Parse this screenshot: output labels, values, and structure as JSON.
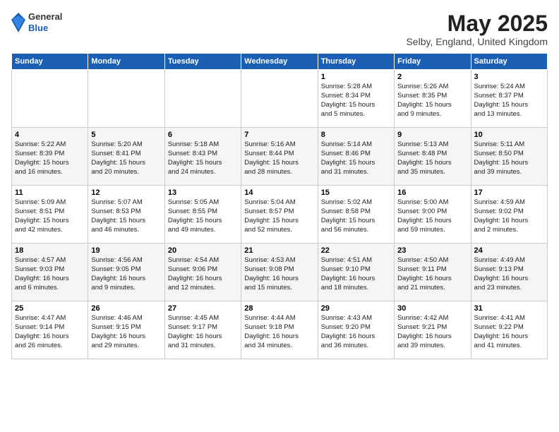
{
  "header": {
    "logo_general": "General",
    "logo_blue": "Blue",
    "month_title": "May 2025",
    "location": "Selby, England, United Kingdom"
  },
  "weekdays": [
    "Sunday",
    "Monday",
    "Tuesday",
    "Wednesday",
    "Thursday",
    "Friday",
    "Saturday"
  ],
  "weeks": [
    [
      {
        "day": "",
        "info": ""
      },
      {
        "day": "",
        "info": ""
      },
      {
        "day": "",
        "info": ""
      },
      {
        "day": "",
        "info": ""
      },
      {
        "day": "1",
        "info": "Sunrise: 5:28 AM\nSunset: 8:34 PM\nDaylight: 15 hours\nand 5 minutes."
      },
      {
        "day": "2",
        "info": "Sunrise: 5:26 AM\nSunset: 8:35 PM\nDaylight: 15 hours\nand 9 minutes."
      },
      {
        "day": "3",
        "info": "Sunrise: 5:24 AM\nSunset: 8:37 PM\nDaylight: 15 hours\nand 13 minutes."
      }
    ],
    [
      {
        "day": "4",
        "info": "Sunrise: 5:22 AM\nSunset: 8:39 PM\nDaylight: 15 hours\nand 16 minutes."
      },
      {
        "day": "5",
        "info": "Sunrise: 5:20 AM\nSunset: 8:41 PM\nDaylight: 15 hours\nand 20 minutes."
      },
      {
        "day": "6",
        "info": "Sunrise: 5:18 AM\nSunset: 8:43 PM\nDaylight: 15 hours\nand 24 minutes."
      },
      {
        "day": "7",
        "info": "Sunrise: 5:16 AM\nSunset: 8:44 PM\nDaylight: 15 hours\nand 28 minutes."
      },
      {
        "day": "8",
        "info": "Sunrise: 5:14 AM\nSunset: 8:46 PM\nDaylight: 15 hours\nand 31 minutes."
      },
      {
        "day": "9",
        "info": "Sunrise: 5:13 AM\nSunset: 8:48 PM\nDaylight: 15 hours\nand 35 minutes."
      },
      {
        "day": "10",
        "info": "Sunrise: 5:11 AM\nSunset: 8:50 PM\nDaylight: 15 hours\nand 39 minutes."
      }
    ],
    [
      {
        "day": "11",
        "info": "Sunrise: 5:09 AM\nSunset: 8:51 PM\nDaylight: 15 hours\nand 42 minutes."
      },
      {
        "day": "12",
        "info": "Sunrise: 5:07 AM\nSunset: 8:53 PM\nDaylight: 15 hours\nand 46 minutes."
      },
      {
        "day": "13",
        "info": "Sunrise: 5:05 AM\nSunset: 8:55 PM\nDaylight: 15 hours\nand 49 minutes."
      },
      {
        "day": "14",
        "info": "Sunrise: 5:04 AM\nSunset: 8:57 PM\nDaylight: 15 hours\nand 52 minutes."
      },
      {
        "day": "15",
        "info": "Sunrise: 5:02 AM\nSunset: 8:58 PM\nDaylight: 15 hours\nand 56 minutes."
      },
      {
        "day": "16",
        "info": "Sunrise: 5:00 AM\nSunset: 9:00 PM\nDaylight: 15 hours\nand 59 minutes."
      },
      {
        "day": "17",
        "info": "Sunrise: 4:59 AM\nSunset: 9:02 PM\nDaylight: 16 hours\nand 2 minutes."
      }
    ],
    [
      {
        "day": "18",
        "info": "Sunrise: 4:57 AM\nSunset: 9:03 PM\nDaylight: 16 hours\nand 6 minutes."
      },
      {
        "day": "19",
        "info": "Sunrise: 4:56 AM\nSunset: 9:05 PM\nDaylight: 16 hours\nand 9 minutes."
      },
      {
        "day": "20",
        "info": "Sunrise: 4:54 AM\nSunset: 9:06 PM\nDaylight: 16 hours\nand 12 minutes."
      },
      {
        "day": "21",
        "info": "Sunrise: 4:53 AM\nSunset: 9:08 PM\nDaylight: 16 hours\nand 15 minutes."
      },
      {
        "day": "22",
        "info": "Sunrise: 4:51 AM\nSunset: 9:10 PM\nDaylight: 16 hours\nand 18 minutes."
      },
      {
        "day": "23",
        "info": "Sunrise: 4:50 AM\nSunset: 9:11 PM\nDaylight: 16 hours\nand 21 minutes."
      },
      {
        "day": "24",
        "info": "Sunrise: 4:49 AM\nSunset: 9:13 PM\nDaylight: 16 hours\nand 23 minutes."
      }
    ],
    [
      {
        "day": "25",
        "info": "Sunrise: 4:47 AM\nSunset: 9:14 PM\nDaylight: 16 hours\nand 26 minutes."
      },
      {
        "day": "26",
        "info": "Sunrise: 4:46 AM\nSunset: 9:15 PM\nDaylight: 16 hours\nand 29 minutes."
      },
      {
        "day": "27",
        "info": "Sunrise: 4:45 AM\nSunset: 9:17 PM\nDaylight: 16 hours\nand 31 minutes."
      },
      {
        "day": "28",
        "info": "Sunrise: 4:44 AM\nSunset: 9:18 PM\nDaylight: 16 hours\nand 34 minutes."
      },
      {
        "day": "29",
        "info": "Sunrise: 4:43 AM\nSunset: 9:20 PM\nDaylight: 16 hours\nand 36 minutes."
      },
      {
        "day": "30",
        "info": "Sunrise: 4:42 AM\nSunset: 9:21 PM\nDaylight: 16 hours\nand 39 minutes."
      },
      {
        "day": "31",
        "info": "Sunrise: 4:41 AM\nSunset: 9:22 PM\nDaylight: 16 hours\nand 41 minutes."
      }
    ]
  ]
}
